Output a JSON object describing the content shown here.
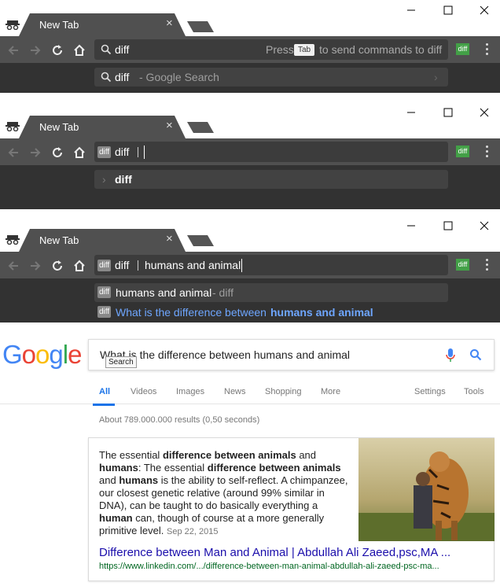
{
  "panels": [
    {
      "tab_title": "New Tab",
      "tab_close": "×",
      "omnibox_text": "diff",
      "omnibox_hint_prefix": "Press",
      "omnibox_hint_key": "Tab",
      "omnibox_hint_suffix": "to send commands to diff",
      "suggestion_main": "diff",
      "suggestion_sub": "- Google Search",
      "suggestion_arrow": "›"
    },
    {
      "tab_title": "New Tab",
      "tab_close": "×",
      "chip": "diff",
      "omnibox_keyword": "diff",
      "suggestion_main": "diff",
      "suggestion_arrow": "›"
    },
    {
      "tab_title": "New Tab",
      "tab_close": "×",
      "chip": "diff",
      "omnibox_keyword": "diff",
      "omnibox_query": "humans and animal",
      "suggestion_chip": "diff",
      "suggestion_main": "humans and animal",
      "suggestion_sub": "- diff",
      "suggestion2_chip": "diff",
      "suggestion2_prefix": "What is the difference between",
      "suggestion2_bold": "humans and animal"
    }
  ],
  "extension_label": "diff",
  "google": {
    "logo": [
      "G",
      "o",
      "o",
      "g",
      "l",
      "e"
    ],
    "logo_colors": [
      "#4285f4",
      "#ea4335",
      "#fbbc05",
      "#4285f4",
      "#34a853",
      "#ea4335"
    ],
    "query": "What is the difference between humans and animal",
    "tooltip": "Search",
    "tabs": [
      "All",
      "Videos",
      "Images",
      "News",
      "Shopping",
      "More"
    ],
    "tools": [
      "Settings",
      "Tools"
    ],
    "results_count": "About 789.000.000 results (0,50 seconds)",
    "snippet": {
      "p1": "The essential ",
      "b1": "difference between animals",
      "p2": " and ",
      "b2": "humans",
      "p3": ": The essential ",
      "b3": "difference between animals",
      "p4": " and ",
      "b4": "humans",
      "p5": " is the ability to self-reflect. A chimpanzee, our closest genetic relative (around 99% similar in DNA), can be taught to do basically everything a ",
      "b5": "human",
      "p6": " can, though of course at a more generally primitive level.",
      "date": "Sep 22, 2015"
    },
    "result_title": "Difference between Man and Animal | Abdullah Ali Zaeed,psc,MA ...",
    "result_url": "https://www.linkedin.com/.../difference-between-man-animal-abdullah-ali-zaeed-psc-ma..."
  }
}
